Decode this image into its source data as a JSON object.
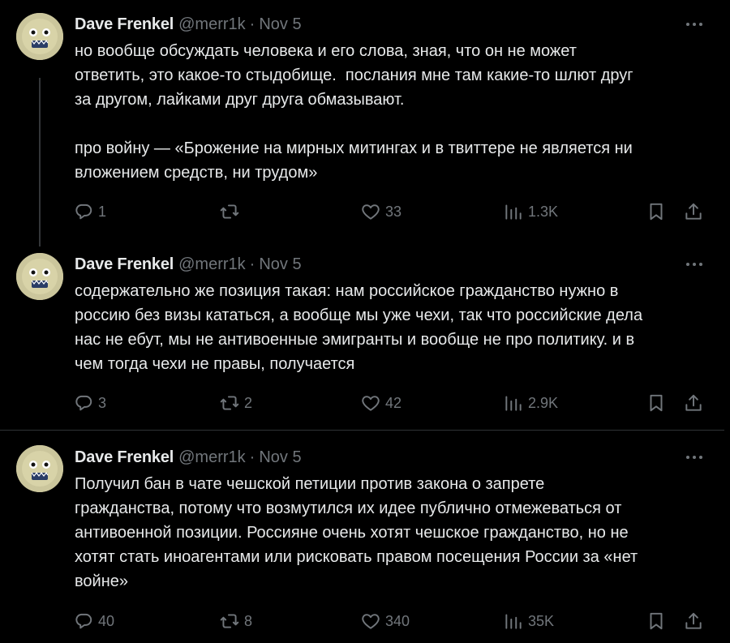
{
  "tweets": [
    {
      "author": "Dave Frenkel",
      "handle": "@merr1k",
      "separator": "·",
      "date": "Nov 5",
      "text": "но вообще обсуждать человека и его слова, зная, что он не может\nответить, это какое-то стыдобище.  послания мне там какие-то шлют друг\nза другом, лайками друг друга обмазывают.\n\nпро войну — «Брожение на мирных митингах и в твиттере не является ни\nвложением средств, ни трудом»",
      "replies": "1",
      "reposts": "",
      "likes": "33",
      "views": "1.3K"
    },
    {
      "author": "Dave Frenkel",
      "handle": "@merr1k",
      "separator": "·",
      "date": "Nov 5",
      "text": "содержательно же позиция такая: нам российское гражданство нужно в\nроссию без визы кататься, а вообще мы уже чехи, так что российские дела\nнас не ебут, мы не антивоенные эмигранты и вообще не про политику. и в\nчем тогда чехи не правы, получается",
      "replies": "3",
      "reposts": "2",
      "likes": "42",
      "views": "2.9K"
    },
    {
      "author": "Dave Frenkel",
      "handle": "@merr1k",
      "separator": "·",
      "date": "Nov 5",
      "text": "Получил бан в чате чешской петиции против закона о запрете\nгражданства, потому что возмутился их идее публично отмежеваться от\nантивоенной позиции. Россияне очень хотят чешское гражданство, но не\nхотят стать иноагентами или рисковать правом посещения России за «нет\nвойне»",
      "replies": "40",
      "reposts": "8",
      "likes": "340",
      "views": "35K"
    }
  ],
  "icons": {
    "reply": "reply-icon",
    "repost": "repost-icon",
    "like": "like-icon",
    "views": "views-icon",
    "bookmark": "bookmark-icon",
    "share": "share-icon",
    "more": "more-icon"
  },
  "colors": {
    "background": "#000000",
    "text": "#e7e9ea",
    "secondary": "#71767b",
    "divider": "#2f3336"
  }
}
